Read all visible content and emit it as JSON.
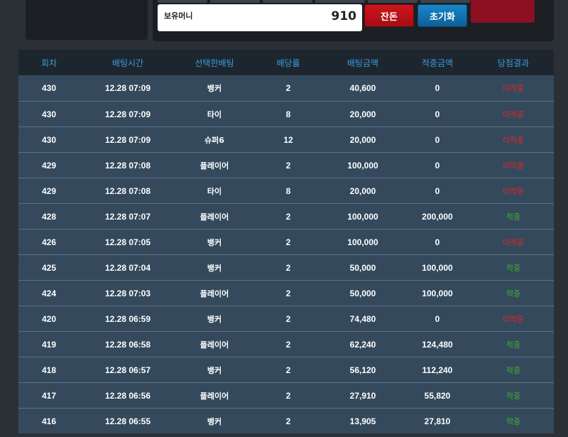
{
  "header": {
    "money_label": "보유머니",
    "money_value": "910",
    "balance_button": "잔돈",
    "reset_button": "초기화"
  },
  "table": {
    "columns": [
      "회차",
      "배팅시간",
      "선택한배팅",
      "배당률",
      "배팅금액",
      "적중금액",
      "당첨결과"
    ],
    "rows": [
      {
        "round": "430",
        "time": "12.28 07:09",
        "pick": "뱅커",
        "odds": "2",
        "bet": "40,600",
        "win": "0",
        "result": "미적중",
        "hit": false
      },
      {
        "round": "430",
        "time": "12.28 07:09",
        "pick": "타이",
        "odds": "8",
        "bet": "20,000",
        "win": "0",
        "result": "미적중",
        "hit": false
      },
      {
        "round": "430",
        "time": "12.28 07:09",
        "pick": "슈퍼6",
        "odds": "12",
        "bet": "20,000",
        "win": "0",
        "result": "미적중",
        "hit": false
      },
      {
        "round": "429",
        "time": "12.28 07:08",
        "pick": "플레이어",
        "odds": "2",
        "bet": "100,000",
        "win": "0",
        "result": "미적중",
        "hit": false
      },
      {
        "round": "429",
        "time": "12.28 07:08",
        "pick": "타이",
        "odds": "8",
        "bet": "20,000",
        "win": "0",
        "result": "미적중",
        "hit": false
      },
      {
        "round": "428",
        "time": "12.28 07:07",
        "pick": "플레이어",
        "odds": "2",
        "bet": "100,000",
        "win": "200,000",
        "result": "적중",
        "hit": true
      },
      {
        "round": "426",
        "time": "12.28 07:05",
        "pick": "뱅커",
        "odds": "2",
        "bet": "100,000",
        "win": "0",
        "result": "미적중",
        "hit": false
      },
      {
        "round": "425",
        "time": "12.28 07:04",
        "pick": "뱅커",
        "odds": "2",
        "bet": "50,000",
        "win": "100,000",
        "result": "적중",
        "hit": true
      },
      {
        "round": "424",
        "time": "12.28 07:03",
        "pick": "플레이어",
        "odds": "2",
        "bet": "50,000",
        "win": "100,000",
        "result": "적중",
        "hit": true
      },
      {
        "round": "420",
        "time": "12.28 06:59",
        "pick": "뱅커",
        "odds": "2",
        "bet": "74,480",
        "win": "0",
        "result": "미적중",
        "hit": false
      },
      {
        "round": "419",
        "time": "12.28 06:58",
        "pick": "플레이어",
        "odds": "2",
        "bet": "62,240",
        "win": "124,480",
        "result": "적중",
        "hit": true
      },
      {
        "round": "418",
        "time": "12.28 06:57",
        "pick": "뱅커",
        "odds": "2",
        "bet": "56,120",
        "win": "112,240",
        "result": "적중",
        "hit": true
      },
      {
        "round": "417",
        "time": "12.28 06:56",
        "pick": "플레이어",
        "odds": "2",
        "bet": "27,910",
        "win": "55,820",
        "result": "적중",
        "hit": true
      },
      {
        "round": "416",
        "time": "12.28 06:55",
        "pick": "뱅커",
        "odds": "2",
        "bet": "13,905",
        "win": "27,810",
        "result": "적중",
        "hit": true
      }
    ]
  },
  "colors": {
    "header_text": "#3b9ce1",
    "row_bg": "#34495c",
    "miss": "#e0262a",
    "hit": "#3eb12e"
  }
}
